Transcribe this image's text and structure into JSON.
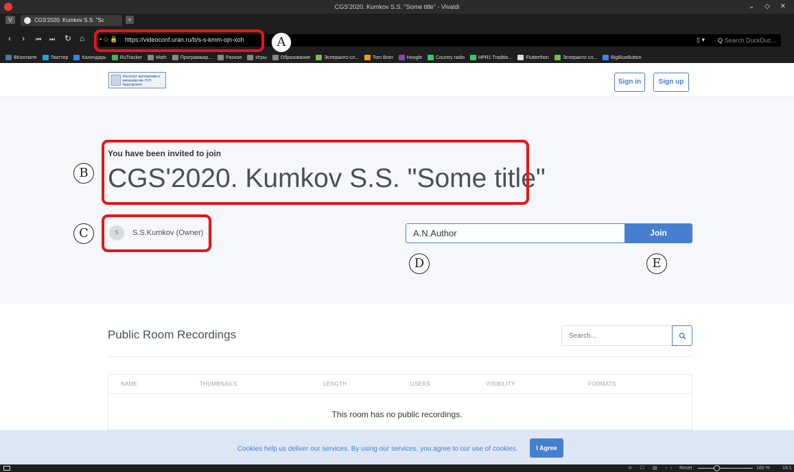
{
  "browser": {
    "window_title": "CGS'2020. Kumkov S.S. \"Some title\" - Vivaldi",
    "window_controls": "⌄ ◇ ✕",
    "tab_title": "CGS'2020. Kumkov S.S. \"Sc",
    "url": "https://videoconf.uran.ru/b/s-s-kmm-ojn-xoh",
    "search_placeholder": "Search DuckDuc...",
    "bookmarks": [
      {
        "label": "ВКонтакте",
        "color": "#4a76a8"
      },
      {
        "label": "Твиттер",
        "color": "#1da1f2"
      },
      {
        "label": "Календарь",
        "color": "#3b82f6"
      },
      {
        "label": "RuTracker",
        "color": "#4caf50"
      },
      {
        "label": "Math",
        "color": "#888888"
      },
      {
        "label": "Программир...",
        "color": "#888888"
      },
      {
        "label": "Разное",
        "color": "#888888"
      },
      {
        "label": "Игры",
        "color": "#888888"
      },
      {
        "label": "Образование",
        "color": "#888888"
      },
      {
        "label": "Эсперанто-сл...",
        "color": "#6fbf4a"
      },
      {
        "label": "Tom Brier",
        "color": "#f39c12"
      },
      {
        "label": "Hoogle",
        "color": "#8e44ad"
      },
      {
        "label": "Country radio",
        "color": "#2ecc71"
      },
      {
        "label": "HPR1 Traditio...",
        "color": "#2ecc71"
      },
      {
        "label": "Flutterthon",
        "color": "#dddddd"
      },
      {
        "label": "Эсперанто сл...",
        "color": "#6fbf4a"
      },
      {
        "label": "BigBlueButton",
        "color": "#3b82f6"
      }
    ],
    "status": {
      "reset_label": "Reset",
      "zoom_level": "160 %",
      "clock": "18:1",
      "icons": "⊙ ☐ ▤ ‹›"
    }
  },
  "header": {
    "logo_text": "Институт математики и механики им. Н.Н. Красовского",
    "sign_in_label": "Sign in",
    "sign_up_label": "Sign up"
  },
  "hero": {
    "invite_text": "You have been invited to join",
    "room_title": "CGS'2020. Kumkov S.S. \"Some title\"",
    "owner_initial": "S",
    "owner_name": "S.S.Kumkov (Owner)",
    "name_input_value": "A.N.Author",
    "join_label": "Join"
  },
  "annotations": [
    {
      "letter": "A"
    },
    {
      "letter": "B"
    },
    {
      "letter": "C"
    },
    {
      "letter": "D"
    },
    {
      "letter": "E"
    }
  ],
  "recordings": {
    "heading": "Public Room Recordings",
    "search_placeholder": "Search...",
    "columns": [
      "NAME",
      "THUMBNAILS",
      "LENGTH",
      "USERS",
      "VISIBILITY",
      "FORMATS"
    ],
    "empty_message": "This room has no public recordings."
  },
  "cookie_banner": {
    "text": "Cookies help us deliver our services. By using our services, you agree to our use of cookies.",
    "agree_label": "I Agree"
  },
  "colors": {
    "accent": "#467fcf",
    "annotation_red": "#e8141a",
    "hero_bg": "#f5f7fb",
    "cookie_bg": "#dce6f5"
  }
}
